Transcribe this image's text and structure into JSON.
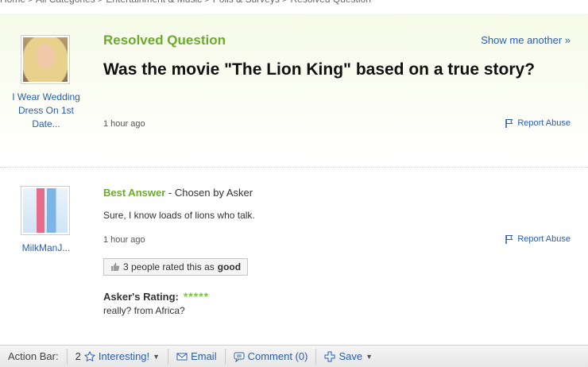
{
  "breadcrumb": {
    "text": "Home > All Categories > Entertainment & Music > Polls & Surveys > Resolved Question"
  },
  "question": {
    "status": "Resolved Question",
    "show_another": "Show me another »",
    "title": "Was the movie \"The Lion King\" based on a true story?",
    "time": "1 hour ago",
    "report": "Report Abuse",
    "asker_name": "I Wear Wedding Dress On 1st Date..."
  },
  "answer": {
    "best_label": "Best Answer",
    "chosen_by": " - Chosen by Asker",
    "text": "Sure, I know loads of lions who talk.",
    "time": "1 hour ago",
    "report": "Report Abuse",
    "answerer_name": "MilkManJ...",
    "rated_text": "3 people rated this as",
    "rated_word": "good",
    "rating_label": "Asker's Rating:",
    "stars": "*****",
    "rating_comment": "really? from Africa?"
  },
  "action_bar": {
    "label": "Action Bar:",
    "interesting_count": "2",
    "interesting": "Interesting!",
    "email": "Email",
    "comment": "Comment (0)",
    "save": "Save"
  },
  "colors": {
    "accent_green": "#6bab2c",
    "link_blue": "#2a5db0",
    "star_green": "#7cc242"
  }
}
